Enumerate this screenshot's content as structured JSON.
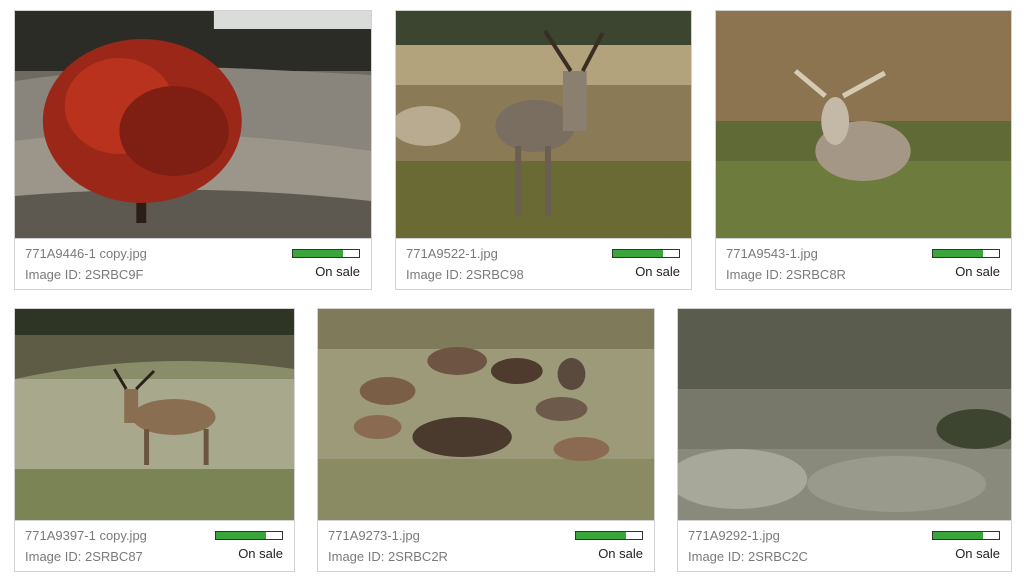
{
  "colors": {
    "progress_fill": "#3aa53a",
    "border": "#d2d2d2",
    "text_muted": "#7a7a7a"
  },
  "gallery": {
    "items": [
      {
        "filename": "771A9446-1 copy.jpg",
        "image_id": "Image ID: 2SRBC9F",
        "status": "On sale",
        "progress": 0.75,
        "subject": "red autumn tree on frosty hillside"
      },
      {
        "filename": "771A9522-1.jpg",
        "image_id": "Image ID: 2SRBC98",
        "status": "On sale",
        "progress": 0.75,
        "subject": "fallow deer stag in field"
      },
      {
        "filename": "771A9543-1.jpg",
        "image_id": "Image ID: 2SRBC8R",
        "status": "On sale",
        "progress": 0.75,
        "subject": "stag resting in tall grass"
      },
      {
        "filename": "771A9397-1 copy.jpg",
        "image_id": "Image ID: 2SRBC87",
        "status": "On sale",
        "progress": 0.75,
        "subject": "stag running across frosty meadow"
      },
      {
        "filename": "771A9273-1.jpg",
        "image_id": "Image ID: 2SRBC2R",
        "status": "On sale",
        "progress": 0.75,
        "subject": "herd of fallow deer"
      },
      {
        "filename": "771A9292-1.jpg",
        "image_id": "Image ID: 2SRBC2C",
        "status": "On sale",
        "progress": 0.75,
        "subject": "frosted grasses close-up"
      }
    ]
  }
}
